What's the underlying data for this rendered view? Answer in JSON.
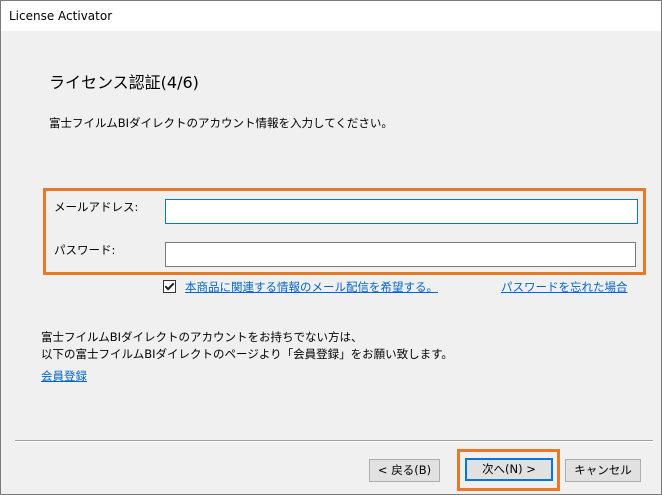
{
  "window": {
    "title": "License Activator"
  },
  "page": {
    "heading": "ライセンス認証(4/6)",
    "instruction": "富士フイルムBIダイレクトのアカウント情報を入力してください。"
  },
  "form": {
    "email_label": "メールアドレス:",
    "email_value": "",
    "password_label": "パスワード:",
    "password_value": ""
  },
  "options": {
    "newsletter_checked": true,
    "newsletter_label": "本商品に関連する情報のメール配信を希望する。",
    "forgot_password_link": "パスワードを忘れた場合"
  },
  "info": {
    "line1": "富士フイルムBIダイレクトのアカウントをお持ちでない方は、",
    "line2": "以下の富士フイルムBIダイレクトのページより「会員登録」をお願い致します。",
    "register_link": "会員登録"
  },
  "buttons": {
    "back": "< 戻る(B)",
    "next": "次へ(N) >",
    "cancel": "キャンセル"
  },
  "colors": {
    "highlight": "#e8782a",
    "link": "#0066cc",
    "focus": "#0078d7"
  }
}
